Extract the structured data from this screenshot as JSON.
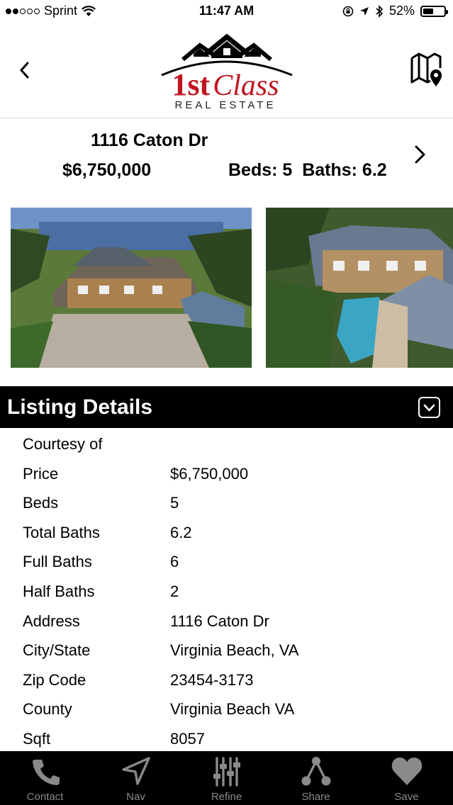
{
  "status_bar": {
    "carrier": "Sprint",
    "time": "11:47 AM",
    "battery": "52%",
    "signal_bars_filled": 2,
    "signal_bars_total": 5
  },
  "header": {
    "logo_first": "1st",
    "logo_class": "Class",
    "logo_sub": "REAL ESTATE",
    "icons": {
      "back": "chevron-left-icon",
      "map": "map-pin-icon"
    }
  },
  "listing": {
    "address": "1116 Caton Dr",
    "price": "$6,750,000",
    "beds_baths": "Beds: 5  Baths: 6.2"
  },
  "photos": [
    "aerial-front-view",
    "aerial-pool-view"
  ],
  "details_section": {
    "title": "Listing Details",
    "rows": [
      {
        "label": "Courtesy of",
        "value": ""
      },
      {
        "label": "Price",
        "value": "$6,750,000"
      },
      {
        "label": "Beds",
        "value": "5"
      },
      {
        "label": "Total Baths",
        "value": "6.2"
      },
      {
        "label": "Full Baths",
        "value": "6"
      },
      {
        "label": "Half Baths",
        "value": "2"
      },
      {
        "label": "Address",
        "value": "1116 Caton Dr"
      },
      {
        "label": "City/State",
        "value": "Virginia Beach, VA"
      },
      {
        "label": "Zip Code",
        "value": "23454-3173"
      },
      {
        "label": "County",
        "value": "Virginia Beach VA"
      },
      {
        "label": "Sqft",
        "value": "8057"
      }
    ]
  },
  "tabbar": {
    "tabs": [
      {
        "label": "Contact",
        "icon": "phone-icon"
      },
      {
        "label": "Nav",
        "icon": "navigation-arrow-icon"
      },
      {
        "label": "Refine",
        "icon": "sliders-icon"
      },
      {
        "label": "Share",
        "icon": "share-icon"
      },
      {
        "label": "Save",
        "icon": "heart-icon"
      }
    ]
  },
  "colors": {
    "brand_red": "#c0151f",
    "bar_black": "#000000",
    "tab_label_gray": "#8a8a8a"
  }
}
